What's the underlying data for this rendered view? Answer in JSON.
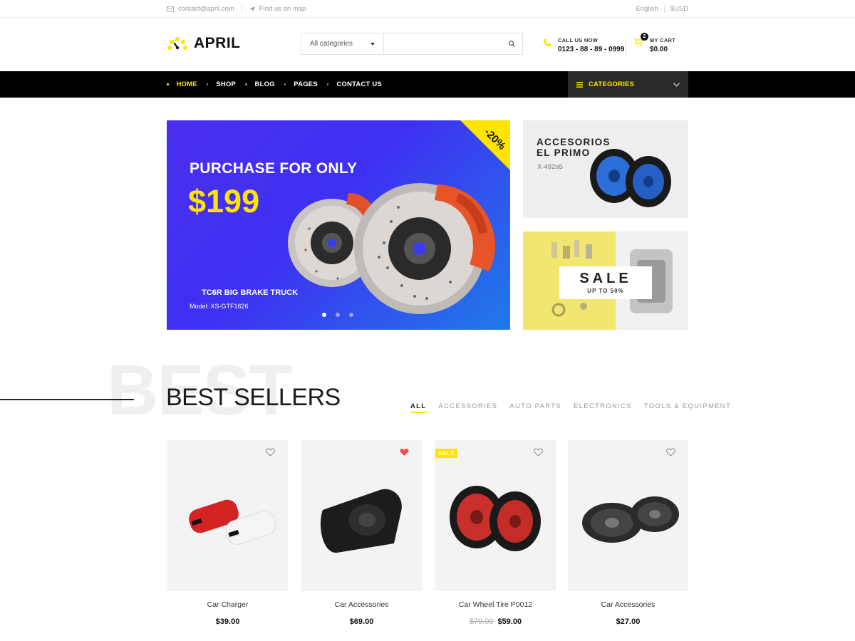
{
  "topbar": {
    "email": "contact@april.com",
    "map_link": "Find us on map",
    "language": "English",
    "currency": "$USD"
  },
  "header": {
    "logo": "APRIL",
    "search": {
      "category": "All categories",
      "placeholder": ""
    },
    "call": {
      "label": "CALL US NOW",
      "number": "0123 - 88 - 89 - 0999"
    },
    "cart": {
      "label": "MY CART",
      "total": "$0.00",
      "count": "2"
    }
  },
  "nav": {
    "items": [
      {
        "label": "HOME",
        "active": true
      },
      {
        "label": "SHOP"
      },
      {
        "label": "BLOG"
      },
      {
        "label": "PAGES"
      },
      {
        "label": "CONTACT US"
      }
    ],
    "categories_label": "CATEGORIES"
  },
  "hero": {
    "heading": "PURCHASE FOR ONLY",
    "price": "$199",
    "discount": "-20%",
    "product_name": "TC6R BIG BRAKE TRUCK",
    "product_model": "Model: XS-GTF1626",
    "active_slide": 1,
    "slide_count": 3
  },
  "banner_accessories": {
    "title_line1": "ACCESORIOS",
    "title_line2": "EL PRIMO",
    "code": "X-492a5"
  },
  "banner_sale": {
    "title": "SALE",
    "subtitle": "UP TO 50%"
  },
  "best_sellers": {
    "watermark": "BEST",
    "title": "BEST SELLERS",
    "tabs": [
      "ALL",
      "ACCESSORIES",
      "AUTO PARTS",
      "ELECTRONICS",
      "TOOLS & EQUIPMENT"
    ],
    "products": [
      {
        "name": "Car Charger",
        "price": "$39.00",
        "old_price": "",
        "wishlisted": false,
        "sale": false
      },
      {
        "name": "Car Accessories",
        "price": "$69.00",
        "old_price": "",
        "wishlisted": true,
        "sale": false
      },
      {
        "name": "Car Wheel Tire P0012",
        "price": "$59.00",
        "old_price": "$79.00",
        "wishlisted": false,
        "sale": true,
        "sale_label": "SALE"
      },
      {
        "name": "Car Accessories",
        "price": "$27.00",
        "old_price": "",
        "wishlisted": false,
        "sale": false
      }
    ]
  },
  "colors": {
    "accent": "#ffe400",
    "nav_bg": "#000000",
    "hero_bg": "#4030f0",
    "wishlist_active": "#f04e4e"
  }
}
